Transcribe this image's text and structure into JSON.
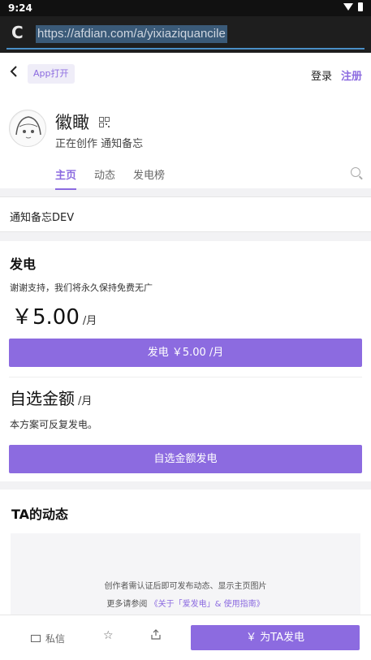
{
  "status_bar": {
    "time": "9:24"
  },
  "browser": {
    "url": "https://afdian.com/a/yixiaziquancile"
  },
  "nav": {
    "back_icon": "chevron-left-icon",
    "app_open": "App打开",
    "login": "登录",
    "register": "注册"
  },
  "profile": {
    "name": "徽瞰",
    "bio": "正在创作 通知备忘",
    "tabs": [
      {
        "label": "主页",
        "active": true
      },
      {
        "label": "动态",
        "active": false
      },
      {
        "label": "发电榜",
        "active": false
      }
    ]
  },
  "notice": {
    "text": "通知备忘DEV"
  },
  "sponsor": {
    "title": "发电",
    "thanks": "谢谢支持，我们将永久保持免费无广",
    "price": "￥5.00",
    "per": "/月",
    "button": "发电 ￥5.00 /月",
    "custom_title": "自选金额",
    "custom_per": "/月",
    "custom_desc": "本方案可反复发电。",
    "custom_button": "自选金额发电"
  },
  "dynamics": {
    "title": "TA的动态",
    "line1": "创作者需认证后即可发布动态、显示主页图片",
    "line2_prefix": "更多请参阅",
    "line2_link": "《关于「爱发电」& 使用指南》"
  },
  "bottom_bar": {
    "message": "私信",
    "sponsor_button": "￥  为TA发电"
  },
  "colors": {
    "accent": "#8c6be0",
    "background": "#f2f2f4"
  }
}
